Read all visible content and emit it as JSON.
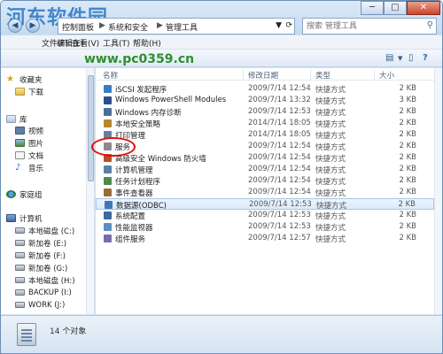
{
  "watermark": {
    "text": "河东软件园",
    "url": "www.pc0359.cn"
  },
  "window": {
    "caption_buttons": {
      "min": "─",
      "max": "□",
      "close": "✕"
    }
  },
  "address": {
    "segments": [
      "控制面板",
      "系统和安全",
      "管理工具"
    ],
    "separator": "▶",
    "dropdown_icon": "chevron-down-icon",
    "refresh_icon": "refresh-icon"
  },
  "search": {
    "placeholder": "搜索 管理工具",
    "icon": "search-icon"
  },
  "menu": {
    "items": [
      "文件(F)",
      "编辑(E)",
      "查看(V)",
      "工具(T)",
      "帮助(H)"
    ]
  },
  "nav": {
    "favorites": "收藏夹",
    "favorites_items": [
      "下载"
    ],
    "libraries": "库",
    "library_items": [
      "视频",
      "图片",
      "文档",
      "音乐"
    ],
    "homegroup": "家庭组",
    "computer": "计算机",
    "drives": [
      "本地磁盘 (C:)",
      "新加卷 (E:)",
      "新加卷 (F:)",
      "新加卷 (G:)",
      "本地磁盘 (H:)",
      "BACKUP (I:)",
      "WORK (J:)"
    ]
  },
  "columns": {
    "name": "名称",
    "date": "修改日期",
    "type": "类型",
    "size": "大小"
  },
  "files": [
    {
      "name": "iSCSI 发起程序",
      "date": "2009/7/14 12:54",
      "type": "快捷方式",
      "size": "2 KB",
      "color": "#3a7dc2"
    },
    {
      "name": "Windows PowerShell Modules",
      "date": "2009/7/14 13:32",
      "type": "快捷方式",
      "size": "3 KB",
      "color": "#2b4f8c"
    },
    {
      "name": "Windows 内存诊断",
      "date": "2009/7/14 12:53",
      "type": "快捷方式",
      "size": "2 KB",
      "color": "#4b6f9c"
    },
    {
      "name": "本地安全策略",
      "date": "2014/7/14 18:05",
      "type": "快捷方式",
      "size": "2 KB",
      "color": "#b8862b"
    },
    {
      "name": "打印管理",
      "date": "2014/7/14 18:05",
      "type": "快捷方式",
      "size": "2 KB",
      "color": "#6b7f99"
    },
    {
      "name": "服务",
      "date": "2009/7/14 12:54",
      "type": "快捷方式",
      "size": "2 KB",
      "color": "#8a8a8a"
    },
    {
      "name": "高级安全 Windows 防火墙",
      "date": "2009/7/14 12:54",
      "type": "快捷方式",
      "size": "2 KB",
      "color": "#c04a2b"
    },
    {
      "name": "计算机管理",
      "date": "2009/7/14 12:54",
      "type": "快捷方式",
      "size": "2 KB",
      "color": "#5c7fa6"
    },
    {
      "name": "任务计划程序",
      "date": "2009/7/14 12:54",
      "type": "快捷方式",
      "size": "2 KB",
      "color": "#4a8a4a"
    },
    {
      "name": "事件查看器",
      "date": "2009/7/14 12:54",
      "type": "快捷方式",
      "size": "2 KB",
      "color": "#9a6b3a"
    },
    {
      "name": "数据源(ODBC)",
      "date": "2009/7/14 12:53",
      "type": "快捷方式",
      "size": "2 KB",
      "color": "#3f76b8",
      "selected": true
    },
    {
      "name": "系统配置",
      "date": "2009/7/14 12:53",
      "type": "快捷方式",
      "size": "2 KB",
      "color": "#3c6aa0"
    },
    {
      "name": "性能监视器",
      "date": "2009/7/14 12:53",
      "type": "快捷方式",
      "size": "2 KB",
      "color": "#5a8fc4"
    },
    {
      "name": "组件服务",
      "date": "2009/7/14 12:57",
      "type": "快捷方式",
      "size": "2 KB",
      "color": "#7a6bb0"
    }
  ],
  "status": {
    "count": "14 个对象"
  }
}
